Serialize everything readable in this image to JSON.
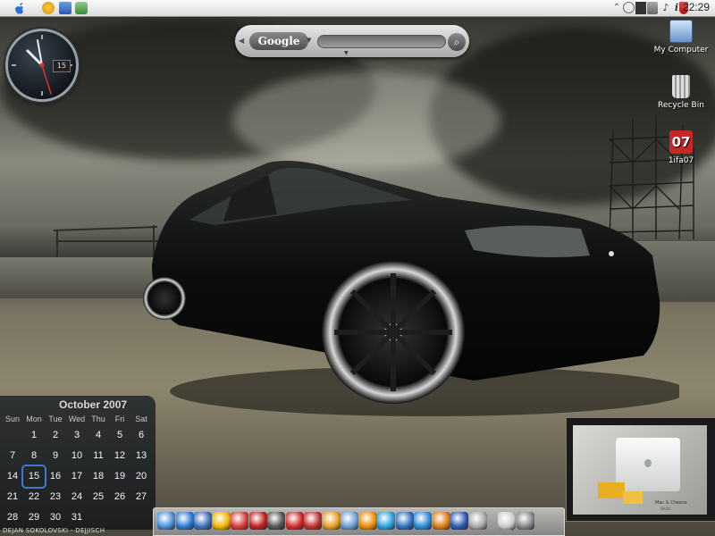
{
  "menubar": {
    "apple_icon": "apple-icon",
    "quicklaunch_icons": [
      "player-icon",
      "monitor-icon",
      "network-icon"
    ],
    "tray_icons": [
      "chevron-up-icon",
      "network-icon",
      "windows-icon",
      "display-icon",
      "speaker-icon",
      "info-icon",
      "shield-icon"
    ],
    "time": "22:29"
  },
  "clock_widget": {
    "date": "15"
  },
  "search": {
    "logo": "Google",
    "placeholder": ""
  },
  "desktop_icons": [
    {
      "label": "My Computer",
      "icon": "computer-icon"
    },
    {
      "label": "Recycle Bin",
      "icon": "trash-icon"
    },
    {
      "label": "1ifa07",
      "icon": "calendar-icon",
      "badge": "07"
    }
  ],
  "calendar": {
    "title": "October 2007",
    "weekdays": [
      "Sun",
      "Mon",
      "Tue",
      "Wed",
      "Thu",
      "Fri",
      "Sat"
    ],
    "weeks": [
      [
        "",
        "1",
        "2",
        "3",
        "4",
        "5",
        "6"
      ],
      [
        "7",
        "8",
        "9",
        "10",
        "11",
        "12",
        "13"
      ],
      [
        "14",
        "15",
        "16",
        "17",
        "18",
        "19",
        "20"
      ],
      [
        "21",
        "22",
        "23",
        "24",
        "25",
        "26",
        "27"
      ],
      [
        "28",
        "29",
        "30",
        "31",
        "",
        "",
        ""
      ]
    ],
    "today": "15"
  },
  "credit": "DEJAN SOKOLOVSKI - DEJJISCH",
  "preview": {
    "caption": "Mac & Cheese",
    "caption2": "BASIC"
  },
  "dock": {
    "items": [
      "finder-icon",
      "ie-icon",
      "pen-icon",
      "pencil-icon",
      "paint-icon",
      "pdf-icon",
      "media-icon",
      "opera-icon",
      "calendar-icon",
      "messenger-icon",
      "download-icon",
      "vlc-icon",
      "player-icon",
      "quicktime-icon",
      "photoshop-icon",
      "winamp-icon",
      "word-icon",
      "apple-icon",
      "documents-icon",
      "trash-icon"
    ],
    "colors": [
      "#4a90d9",
      "#2c7bd6",
      "#3a6fb8",
      "#f0b400",
      "#d83a3a",
      "#c02020",
      "#555555",
      "#d42a2a",
      "#c03030",
      "#e8a020",
      "#6aa0d8",
      "#f08a00",
      "#2aa0e0",
      "#3070c0",
      "#2a8ad8",
      "#e07a10",
      "#2a5ab0",
      "#aaaaaa",
      "#cccccc",
      "#888888"
    ]
  },
  "colors": {
    "menubar": "#e6e6e6",
    "calendar_today": "#3c7bd5",
    "badge_red": "#c62828"
  }
}
